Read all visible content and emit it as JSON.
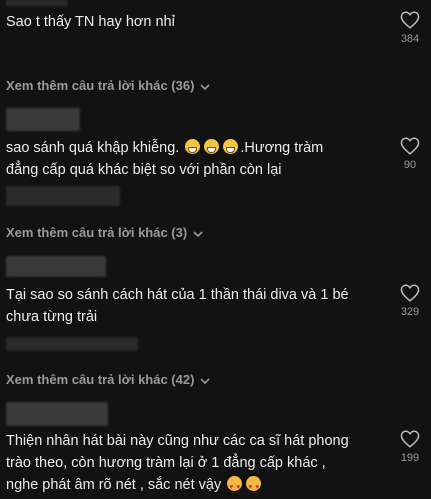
{
  "comments": [
    {
      "text": "Sao t thấy TN hay hơn nhỉ",
      "likes": "384"
    },
    {
      "text_before": "sao sánh quá khập khiễng.",
      "text_after": ".Hương tràm",
      "text_line2": "đẳng cấp quá khác biệt so với phần còn lại",
      "likes": "90"
    },
    {
      "text_line1": "Tại sao so sánh cách hát của 1 thần thái diva và 1 bé",
      "text_line2": "chưa từng trải",
      "likes": "329"
    },
    {
      "text_line1": "Thiện nhân hát bài này cũng như các ca sĩ hát phong",
      "text_line2": "trào theo, còn hương tràm lại ở 1 đẳng cấp khác ,",
      "text_line3": "nghe phát âm rõ nét , sắc nét vậy",
      "likes": "199"
    }
  ],
  "more_replies": [
    {
      "label": "Xem thêm câu trả lời khác (36)"
    },
    {
      "label": "Xem thêm câu trả lời khác (3)"
    },
    {
      "label": "Xem thêm câu trả lời khác (42)"
    }
  ],
  "icons": {
    "like": "heart-outline-icon",
    "expand": "chevron-down-icon",
    "emoji_grin": "grinning-face-emoji",
    "emoji_hearts": "smiling-face-with-hearts-emoji"
  }
}
